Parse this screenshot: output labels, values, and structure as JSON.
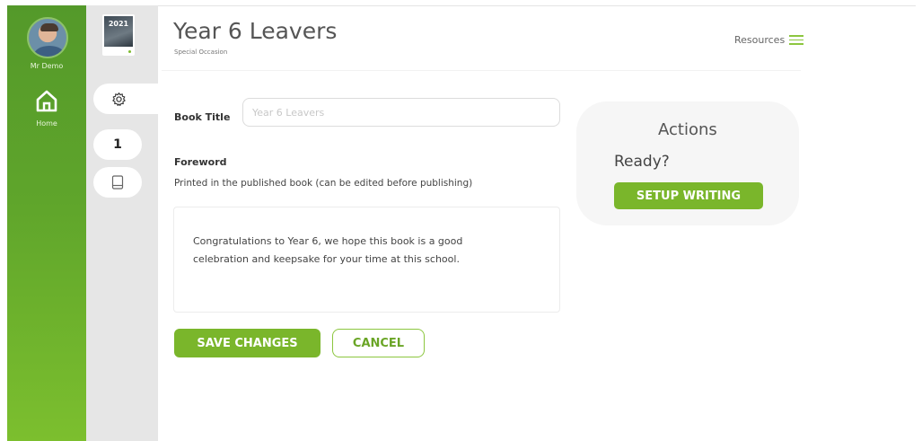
{
  "user": {
    "name": "Mr Demo"
  },
  "nav": {
    "home_label": "Home"
  },
  "book": {
    "thumb_year": "2021"
  },
  "subnav": {
    "items": [
      {
        "icon": "gear-icon"
      },
      {
        "label": "1"
      },
      {
        "icon": "book-icon"
      }
    ]
  },
  "header": {
    "title": "Year 6 Leavers",
    "subtitle": "Special Occasion",
    "resources_label": "Resources"
  },
  "form": {
    "book_title_label": "Book Title",
    "book_title_placeholder": "Year 6 Leavers",
    "foreword_label": "Foreword",
    "foreword_hint": "Printed in the published book (can be edited before publishing)",
    "foreword_text": "Congratulations to Year 6, we hope this book is a good celebration and keepsake for your time at this school.",
    "save_label": "SAVE CHANGES",
    "cancel_label": "CANCEL"
  },
  "actions": {
    "title": "Actions",
    "ready_label": "Ready?",
    "setup_label": "SETUP WRITING"
  },
  "colors": {
    "brand_green": "#7ab62b",
    "rail_green": "#5fa52b",
    "subrail_grey": "#e6e6e6"
  }
}
